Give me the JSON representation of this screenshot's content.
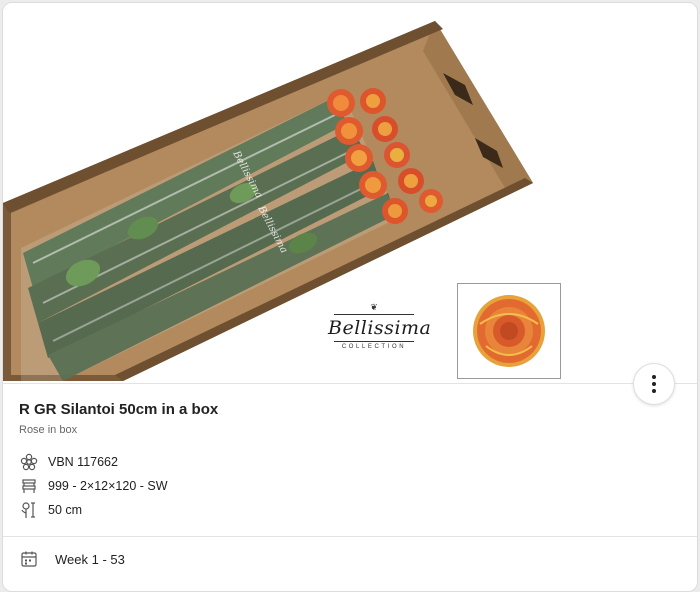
{
  "product": {
    "title": "R GR Silantoi 50cm in a box",
    "subtitle": "Rose in box"
  },
  "specs": [
    {
      "icon": "flower-icon",
      "text": "VBN 117662"
    },
    {
      "icon": "packaging-icon",
      "text": "999 - 2×12×120 - SW"
    },
    {
      "icon": "stem-length-icon",
      "text": "50 cm"
    }
  ],
  "availability": {
    "icon": "calendar-icon",
    "text": "Week 1 - 53"
  },
  "image": {
    "logo_brand": "Bellissima",
    "logo_sub": "COLLECTION",
    "sleeve_text": "Bellissima"
  },
  "actions": {
    "more_icon": "more-vertical-icon"
  },
  "colors": {
    "rose": "#e0572e",
    "rose_edge": "#e8b23a",
    "box": "#8a6a45",
    "accent_text": "#222222"
  }
}
